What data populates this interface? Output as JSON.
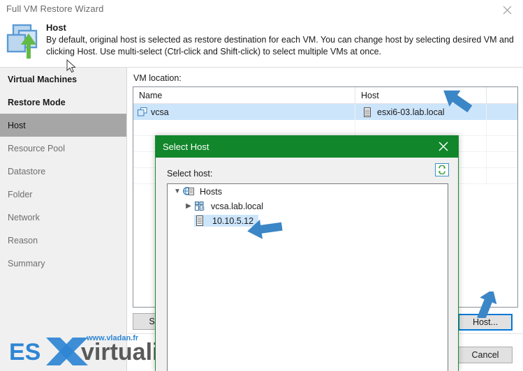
{
  "window": {
    "title": "Full VM Restore Wizard",
    "close_icon": "close-icon"
  },
  "header": {
    "icon": "vm-restore-icon",
    "title": "Host",
    "description": "By default, original host is selected as restore destination for each VM. You can change host by selecting desired VM and clicking Host. Use multi-select (Ctrl-click and Shift-click) to select multiple VMs at once."
  },
  "sidebar": {
    "items": [
      {
        "label": "Virtual Machines",
        "state": "done"
      },
      {
        "label": "Restore Mode",
        "state": "done"
      },
      {
        "label": "Host",
        "state": "active"
      },
      {
        "label": "Resource Pool",
        "state": "pending"
      },
      {
        "label": "Datastore",
        "state": "pending"
      },
      {
        "label": "Folder",
        "state": "pending"
      },
      {
        "label": "Network",
        "state": "pending"
      },
      {
        "label": "Reason",
        "state": "pending"
      },
      {
        "label": "Summary",
        "state": "pending"
      }
    ]
  },
  "main": {
    "vm_location_label": "VM location:",
    "grid": {
      "columns": [
        "Name",
        "Host",
        ""
      ],
      "rows": [
        {
          "name": "vcsa",
          "host": "esxi6-03.lab.local",
          "extra": "",
          "selected": true
        }
      ]
    },
    "buttons": {
      "select_hidden": "Select...",
      "host": "Host...",
      "cancel": "Cancel"
    }
  },
  "modal": {
    "title": "Select Host",
    "close_icon": "close-icon",
    "select_host_label": "Select host:",
    "rescan_icon": "rescan-icon",
    "tree": [
      {
        "label": "Hosts",
        "level": 1,
        "expander": "expanded",
        "icon": "hosts-group-icon",
        "selected": false
      },
      {
        "label": "vcsa.lab.local",
        "level": 2,
        "expander": "collapsed",
        "icon": "vcenter-icon",
        "selected": false
      },
      {
        "label": "10.10.5.12",
        "level": 3,
        "expander": "none",
        "icon": "esxi-host-icon",
        "selected": true
      }
    ]
  },
  "annotations": {
    "arrow_host_column": "blue-arrow-icon",
    "arrow_tree_item": "blue-arrow-icon",
    "arrow_host_button": "blue-arrow-icon"
  },
  "watermark": {
    "url_text": "www.vladan.fr",
    "brand_prefix": "ES",
    "brand_x": "X",
    "brand_suffix": "virtualization"
  },
  "colors": {
    "modal_green": "#11862b",
    "selection_blue": "#cce5fb",
    "focus_blue": "#0078d7",
    "nav_active_gray": "#a6a6a6",
    "annotation_blue": "#2e86d4"
  }
}
